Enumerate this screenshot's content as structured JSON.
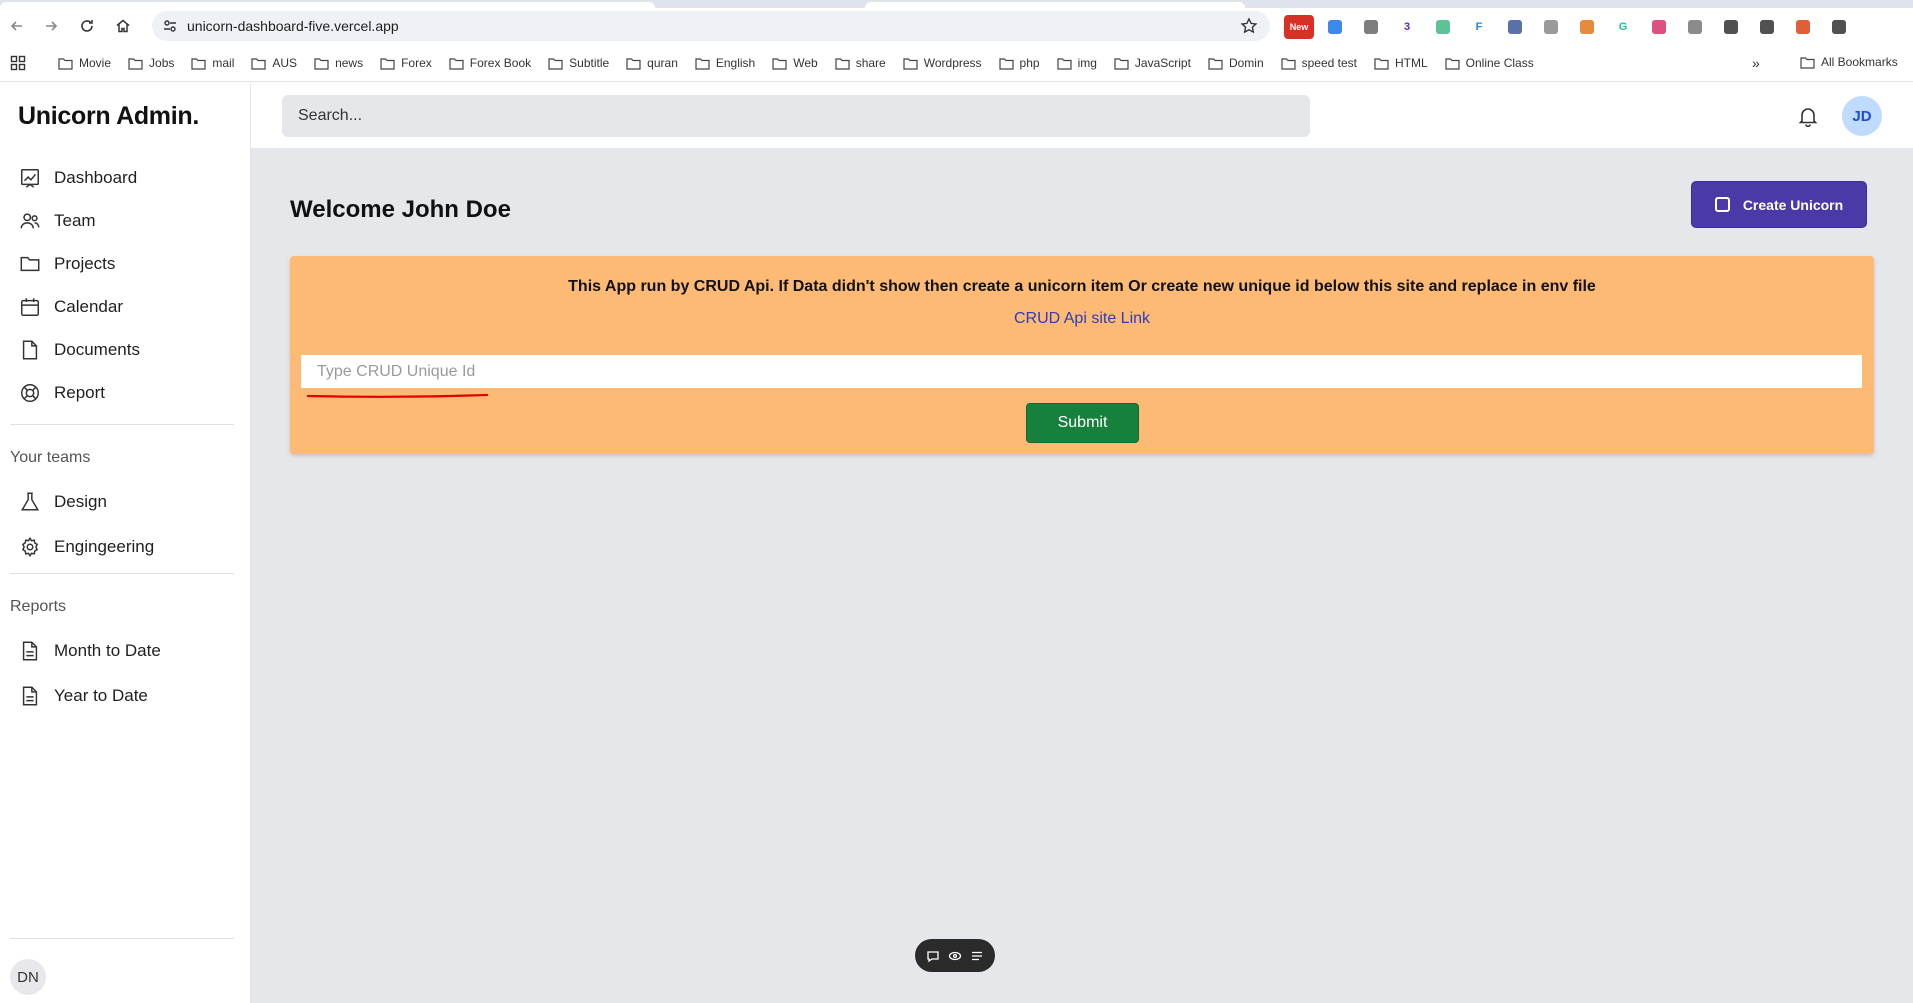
{
  "browser": {
    "url": "unicorn-dashboard-five.vercel.app",
    "extensions": [
      {
        "name": "new-badge-extension-icon",
        "label": "New",
        "color": "#d93025"
      },
      {
        "name": "translate-extension-icon",
        "label": "",
        "color": "#1a73e8"
      },
      {
        "name": "cloud-extension-icon",
        "label": "",
        "color": "#666666"
      },
      {
        "name": "graduation-extension-icon",
        "label": "3",
        "color": "#5b2bbd"
      },
      {
        "name": "vue-extension-icon",
        "label": "",
        "color": "#41b883"
      },
      {
        "name": "f-extension-icon",
        "label": "F",
        "color": "#1e88e5"
      },
      {
        "name": "pen-extension-icon",
        "label": "",
        "color": "#3b5998"
      },
      {
        "name": "circle-extension-icon",
        "label": "",
        "color": "#888888"
      },
      {
        "name": "fox-extension-icon",
        "label": "",
        "color": "#e2761b"
      },
      {
        "name": "grammarly-extension-icon",
        "label": "G",
        "color": "#15c39a"
      },
      {
        "name": "co-extension-icon",
        "label": "",
        "color": "#d6336c"
      },
      {
        "name": "book-extension-icon",
        "label": "",
        "color": "#777777"
      },
      {
        "name": "puzzle-extension-icon",
        "label": "",
        "color": "#333333"
      },
      {
        "name": "reading-list-icon",
        "label": "",
        "color": "#333333"
      },
      {
        "name": "profile-extension-icon",
        "label": "",
        "color": "#d84315"
      },
      {
        "name": "menu-dots-icon",
        "label": "",
        "color": "#333333"
      }
    ],
    "bookmarks": [
      "Movie",
      "Jobs",
      "mail",
      "AUS",
      "news",
      "Forex",
      "Forex Book",
      "Subtitle",
      "quran",
      "English",
      "Web",
      "share",
      "Wordpress",
      "php",
      "img",
      "JavaScript",
      "Domin",
      "speed test",
      "HTML",
      "Online Class"
    ],
    "bookmarks_more": "»",
    "all_bookmarks": "All Bookmarks"
  },
  "sidebar": {
    "logo": "Unicorn Admin.",
    "items": [
      {
        "label": "Dashboard",
        "icon": "chart-icon"
      },
      {
        "label": "Team",
        "icon": "users-icon"
      },
      {
        "label": "Projects",
        "icon": "folder-icon"
      },
      {
        "label": "Calendar",
        "icon": "calendar-icon"
      },
      {
        "label": "Documents",
        "icon": "document-icon"
      },
      {
        "label": "Report",
        "icon": "lifebuoy-icon"
      }
    ],
    "teams_title": "Your teams",
    "teams": [
      {
        "label": "Design",
        "icon": "flask-icon"
      },
      {
        "label": "Engingeering",
        "icon": "cog-icon"
      }
    ],
    "reports_title": "Reports",
    "reports": [
      {
        "label": "Month to Date",
        "icon": "document-icon"
      },
      {
        "label": "Year to Date",
        "icon": "document-icon"
      }
    ],
    "user_initials": "DN"
  },
  "header": {
    "search_placeholder": "Search...",
    "avatar_initials": "JD"
  },
  "main": {
    "welcome": "Welcome John Doe",
    "create_button": "Create Unicorn",
    "alert": {
      "message": "This App run by CRUD Api. If Data didn't show then create a unicorn item Or create new unique id below this site and replace in env file",
      "link": "CRUD Api site Link",
      "input_placeholder": "Type CRUD Unique Id",
      "submit": "Submit",
      "background": "#fdba74"
    }
  },
  "colors": {
    "accent": "#4a3aa8",
    "submit": "#16803d",
    "annotation": "#e00000"
  }
}
